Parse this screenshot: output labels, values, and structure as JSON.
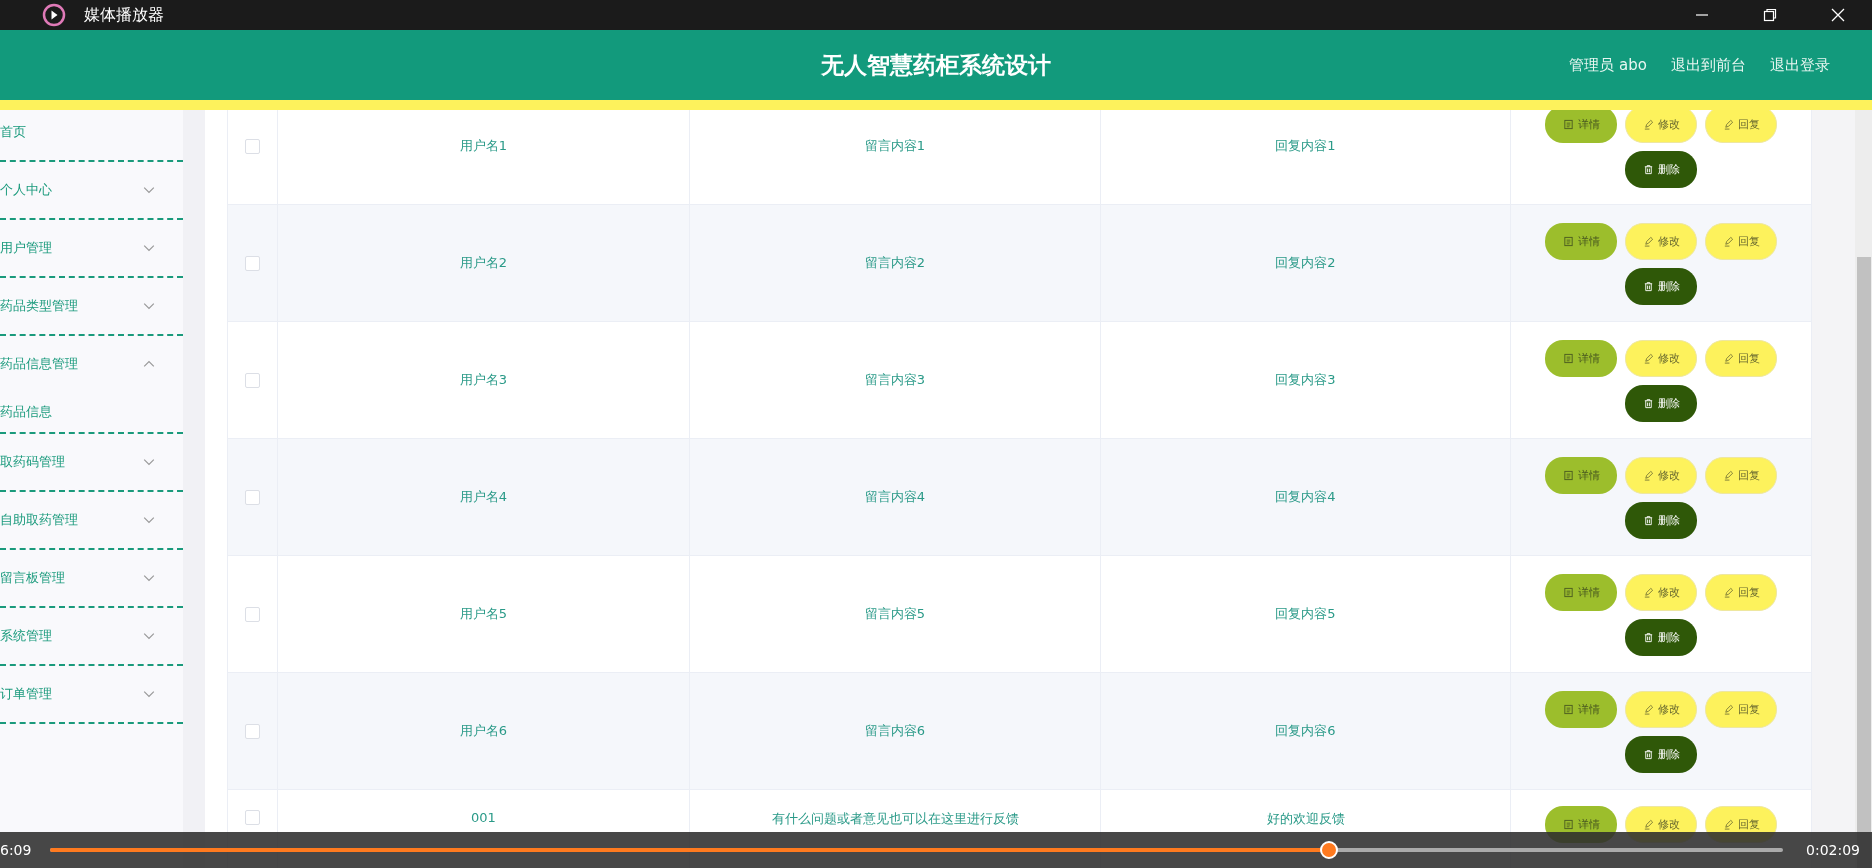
{
  "window": {
    "title": "媒体播放器"
  },
  "header": {
    "title": "无人智慧药柜系统设计",
    "links": [
      "管理员 abo",
      "退出到前台",
      "退出登录"
    ]
  },
  "sidebar": {
    "items": [
      {
        "label": "首页"
      },
      {
        "label": "个人中心",
        "expanded": false
      },
      {
        "label": "用户管理",
        "expanded": false
      },
      {
        "label": "药品类型管理",
        "expanded": false
      },
      {
        "label": "药品信息管理",
        "expanded": true,
        "children": [
          {
            "label": "药品信息"
          }
        ]
      },
      {
        "label": "取药码管理",
        "expanded": false
      },
      {
        "label": "自助取药管理",
        "expanded": false
      },
      {
        "label": "留言板管理",
        "expanded": false
      },
      {
        "label": "系统管理",
        "expanded": false
      },
      {
        "label": "订单管理",
        "expanded": false
      }
    ]
  },
  "table": {
    "rows": [
      {
        "checked": false,
        "cells": [
          "用户名1",
          "留言内容1",
          "回复内容1"
        ],
        "actions": [
          {
            "label": "详情",
            "kind": "detail"
          },
          {
            "label": "修改",
            "kind": "edit"
          },
          {
            "label": "回复",
            "kind": "reply"
          },
          {
            "label": "删除",
            "kind": "delete"
          }
        ]
      },
      {
        "checked": false,
        "cells": [
          "用户名2",
          "留言内容2",
          "回复内容2"
        ],
        "actions": [
          {
            "label": "详情",
            "kind": "detail"
          },
          {
            "label": "修改",
            "kind": "edit"
          },
          {
            "label": "回复",
            "kind": "reply"
          },
          {
            "label": "删除",
            "kind": "delete"
          }
        ]
      },
      {
        "checked": false,
        "cells": [
          "用户名3",
          "留言内容3",
          "回复内容3"
        ],
        "actions": [
          {
            "label": "详情",
            "kind": "detail"
          },
          {
            "label": "修改",
            "kind": "edit"
          },
          {
            "label": "回复",
            "kind": "reply"
          },
          {
            "label": "删除",
            "kind": "delete"
          }
        ]
      },
      {
        "checked": false,
        "cells": [
          "用户名4",
          "留言内容4",
          "回复内容4"
        ],
        "actions": [
          {
            "label": "详情",
            "kind": "detail"
          },
          {
            "label": "修改",
            "kind": "edit"
          },
          {
            "label": "回复",
            "kind": "reply"
          },
          {
            "label": "删除",
            "kind": "delete"
          }
        ]
      },
      {
        "checked": false,
        "cells": [
          "用户名5",
          "留言内容5",
          "回复内容5"
        ],
        "actions": [
          {
            "label": "详情",
            "kind": "detail"
          },
          {
            "label": "修改",
            "kind": "edit"
          },
          {
            "label": "回复",
            "kind": "reply"
          },
          {
            "label": "删除",
            "kind": "delete"
          }
        ]
      },
      {
        "checked": false,
        "cells": [
          "用户名6",
          "留言内容6",
          "回复内容6"
        ],
        "actions": [
          {
            "label": "详情",
            "kind": "detail"
          },
          {
            "label": "修改",
            "kind": "edit"
          },
          {
            "label": "回复",
            "kind": "reply"
          },
          {
            "label": "删除",
            "kind": "delete"
          }
        ]
      },
      {
        "checked": false,
        "cells": [
          "001",
          "有什么问题或者意见也可以在这里进行反馈",
          "好的欢迎反馈"
        ],
        "actions": [
          {
            "label": "详情",
            "kind": "detail"
          },
          {
            "label": "修改",
            "kind": "edit"
          },
          {
            "label": "回复",
            "kind": "reply"
          }
        ]
      }
    ]
  },
  "player": {
    "elapsed": "6:09",
    "remaining": "0:02:09",
    "level": 0.738
  }
}
